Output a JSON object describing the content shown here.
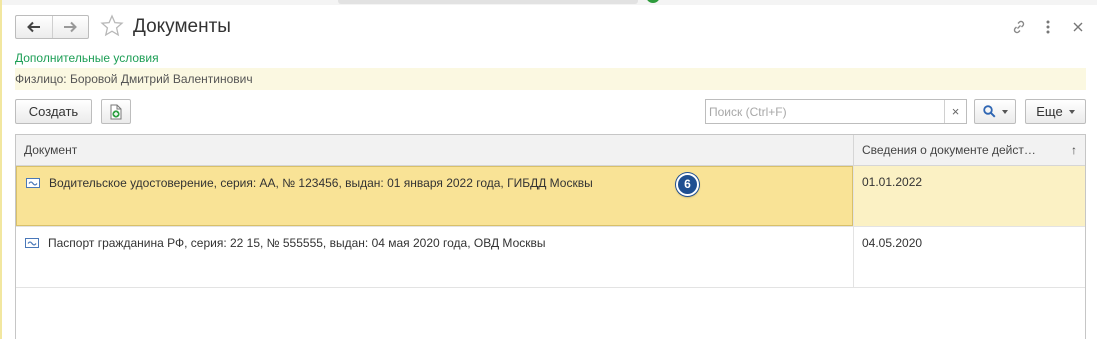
{
  "window": {
    "title": "Документы"
  },
  "header": {
    "back_icon": "arrow-left-icon",
    "forward_icon": "arrow-right-icon",
    "favorite_icon": "star-icon",
    "link_icon": "link-icon",
    "more_icon": "more-vertical-icon",
    "close_icon": "close-icon"
  },
  "info": {
    "additional_conditions": "Дополнительные условия",
    "person": "Физлицо: Боровой Дмитрий Валентинович"
  },
  "toolbar": {
    "create_label": "Создать",
    "add_icon": "add-document-icon",
    "search_placeholder": "Поиск (Ctrl+F)",
    "search_value": "",
    "clear_label": "×",
    "more_label": "Еще"
  },
  "table": {
    "columns": [
      {
        "label": "Документ"
      },
      {
        "label": "Сведения о документе дейст…",
        "sort": "↑"
      }
    ],
    "rows": [
      {
        "document": "Водительское удостоверение, серия: АА, № 123456, выдан: 01 января 2022 года, ГИБДД Москвы",
        "date": "01.01.2022",
        "selected": true
      },
      {
        "document": "Паспорт гражданина РФ, серия: 22 15, № 555555, выдан: 04 мая 2020 года, ОВД Москвы",
        "date": "04.05.2020",
        "selected": false
      }
    ]
  },
  "annotation": {
    "badge": "6"
  },
  "colors": {
    "accent_green": "#1c9e55",
    "selection": "#f9e396",
    "badge": "#1f4f91"
  }
}
